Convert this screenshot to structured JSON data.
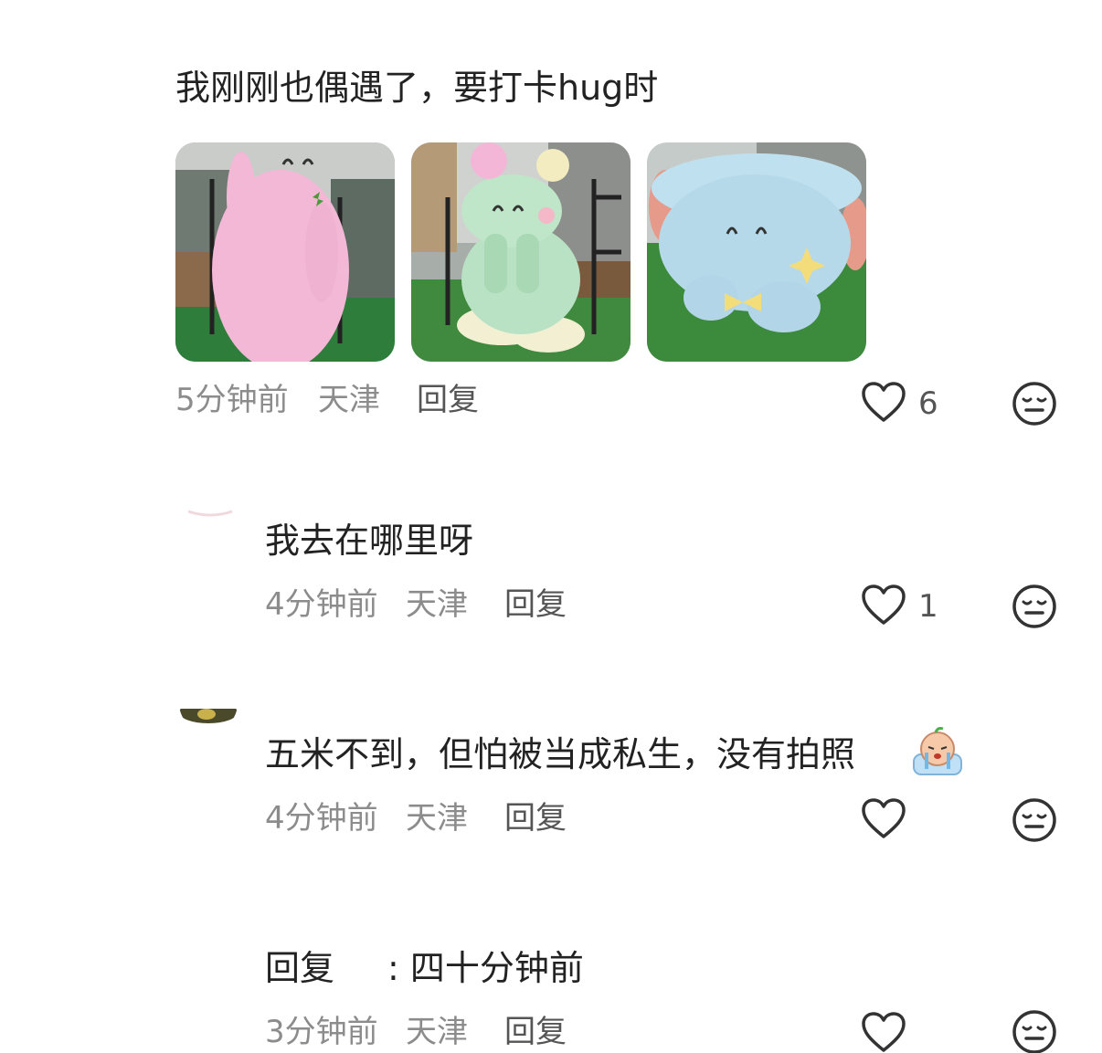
{
  "comments": [
    {
      "text": "我刚刚也偶遇了，要打卡hug时",
      "time": "5分钟前",
      "location": "天津",
      "reply_label": "回复",
      "likes": "6",
      "photos": [
        {
          "subject": "pink inflatable character"
        },
        {
          "subject": "mint green inflatable character"
        },
        {
          "subject": "light blue inflatable character"
        }
      ]
    },
    {
      "text": "我去在哪里呀",
      "time": "4分钟前",
      "location": "天津",
      "reply_label": "回复",
      "likes": "1"
    },
    {
      "text": "五米不到，但怕被当成私生，没有拍照",
      "emoji": "crying-emoji-sticker",
      "time": "4分钟前",
      "location": "天津",
      "reply_label": "回复",
      "likes": ""
    },
    {
      "reply_prefix": "回复",
      "reply_text": ": 四十分钟前",
      "time": "3分钟前",
      "location": "天津",
      "reply_label": "回复",
      "likes": ""
    }
  ],
  "icons": {
    "like": "heart-outline-icon",
    "more": "meh-face-icon"
  },
  "colors": {
    "text": "#222222",
    "meta": "#8c8c8c",
    "icon": "#333333"
  }
}
